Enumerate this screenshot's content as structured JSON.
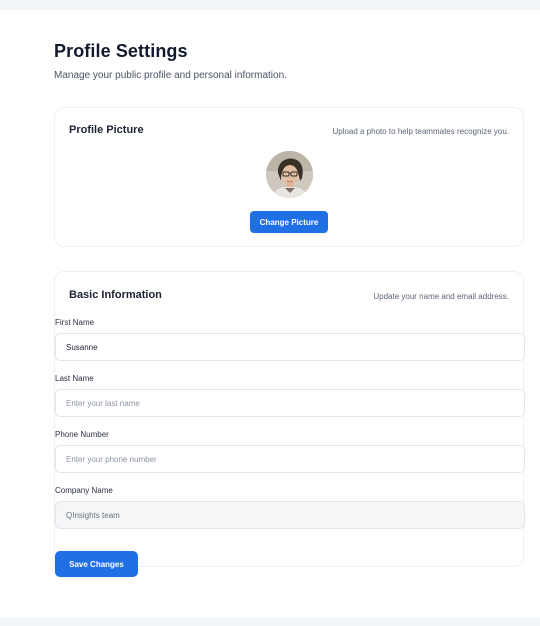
{
  "page": {
    "title": "Profile Settings",
    "subtitle": "Manage your public profile and personal information."
  },
  "profile_picture": {
    "title": "Profile Picture",
    "description": "Upload a photo to help teammates recognize you.",
    "change_button": "Change Picture",
    "avatar_icon": "user-photo"
  },
  "basic_info": {
    "title": "Basic Information",
    "description": "Update your name and email address.",
    "first_name": {
      "label": "First Name",
      "value": "Susanne",
      "placeholder": ""
    },
    "last_name": {
      "label": "Last Name",
      "value": "",
      "placeholder": "Enter your last name"
    },
    "phone": {
      "label": "Phone Number",
      "value": "",
      "placeholder": "Enter your phone number"
    },
    "company": {
      "label": "Company Name",
      "value": "QInsights team",
      "placeholder": ""
    },
    "save_button": "Save Changes"
  },
  "colors": {
    "accent": "#1f6fe5",
    "background": "#f1f4f9"
  }
}
